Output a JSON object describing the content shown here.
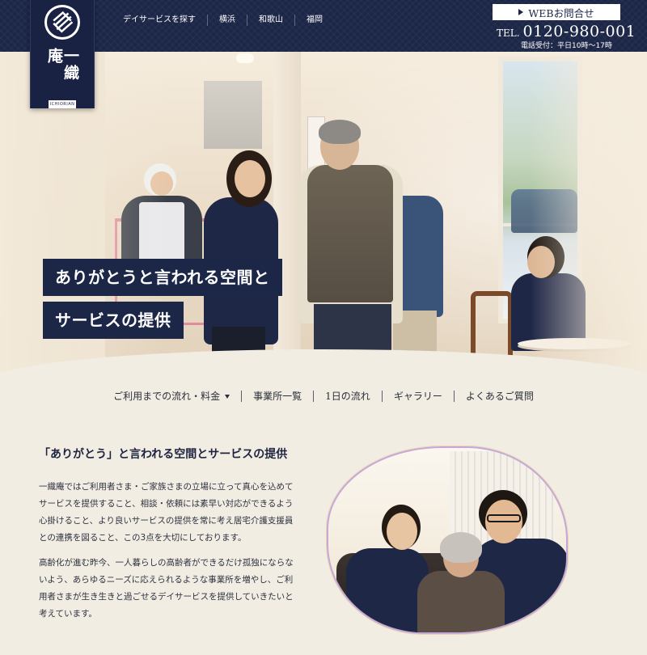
{
  "brand": {
    "name": "一織庵",
    "sub": "ICHIORIAN"
  },
  "topnav": {
    "items": [
      {
        "label": "デイサービスを探す"
      },
      {
        "label": "横浜"
      },
      {
        "label": "和歌山"
      },
      {
        "label": "福岡"
      }
    ]
  },
  "contact": {
    "web_button": "WEBお問合せ",
    "tel_label": "TEL.",
    "tel_number": "0120-980-001",
    "hours": "電話受付：平日10時～17時"
  },
  "hero": {
    "line1": "ありがとうと言われる空間と",
    "line2": "サービスの提供"
  },
  "subnav": {
    "items": [
      {
        "label": "ご利用までの流れ・料金"
      },
      {
        "label": "事業所一覧"
      },
      {
        "label": "1日の流れ"
      },
      {
        "label": "ギャラリー"
      },
      {
        "label": "よくあるご質問"
      }
    ]
  },
  "intro": {
    "title": "「ありがとう」と言われる空間とサービスの提供",
    "p1": "一織庵ではご利用者さま・ご家族さまの立場に立って真心を込めてサービスを提供すること、相談・依頼には素早い対応ができるよう心掛けること、より良いサービスの提供を常に考え居宅介護支援員との連携を図ること、この3点を大切にしております。",
    "p2": "高齢化が進む昨今、一人暮らしの高齢者ができるだけ孤独にならないよう、あらゆるニーズに応えられるような事業所を増やし、ご利用者さまが生き生きと過ごせるデイサービスを提供していきたいと考えています。"
  },
  "colors": {
    "navy": "#1c2647",
    "background": "#f1ede3",
    "text": "#2b2f3a"
  }
}
